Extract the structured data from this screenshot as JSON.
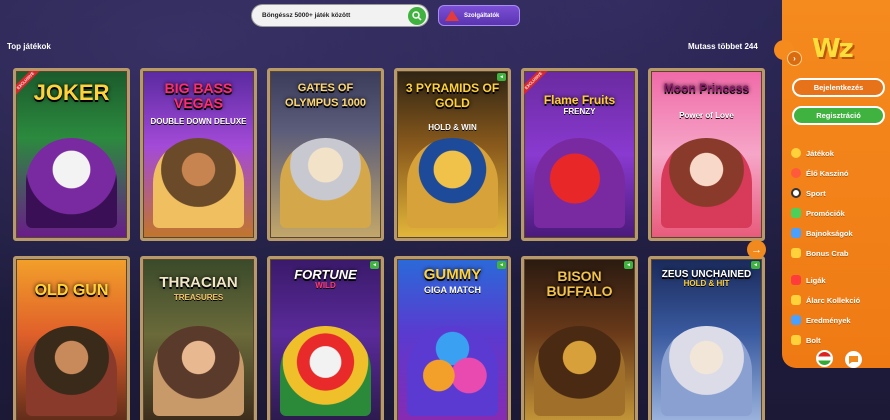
{
  "search": {
    "placeholder": "Böngéssz 5000+ játék között"
  },
  "providers": {
    "label": "Szolgáltatók"
  },
  "section": {
    "title": "Top játékok",
    "more": "Mutass többet 244"
  },
  "games": [
    {
      "name": "JOKER",
      "sub": "",
      "badge": "EXCLUSIVE",
      "quick": false
    },
    {
      "name": "BIG BASS VEGAS",
      "sub": "DOUBLE DOWN DELUXE",
      "badge": "",
      "quick": false
    },
    {
      "name": "GATES OF OLYMPUS 1000",
      "sub": "",
      "badge": "",
      "quick": false
    },
    {
      "name": "3 PYRAMIDS OF GOLD",
      "sub": "HOLD & WIN",
      "badge": "",
      "quick": true
    },
    {
      "name": "Flame Fruits",
      "sub": "FRENZY",
      "badge": "EXCLUSIVE",
      "quick": false
    },
    {
      "name": "Moon Princess",
      "sub": "Power of Love",
      "badge": "",
      "quick": false
    },
    {
      "name": "OLD GUN",
      "sub": "",
      "badge": "",
      "quick": false
    },
    {
      "name": "THRACIAN",
      "sub": "TREASURES",
      "badge": "",
      "quick": false
    },
    {
      "name": "FORTUNE",
      "sub": "WILD",
      "badge": "",
      "quick": true
    },
    {
      "name": "GUMMY",
      "sub": "GIGA MATCH",
      "badge": "",
      "quick": true
    },
    {
      "name": "BISON BUFFALO",
      "sub": "",
      "badge": "",
      "quick": true
    },
    {
      "name": "ZEUS UNCHAINED",
      "sub": "HOLD & HIT",
      "badge": "",
      "quick": true
    }
  ],
  "sidebar": {
    "logo": "Wz",
    "login": "Bejelentkezés",
    "register": "Regisztráció",
    "items": [
      {
        "label": "Játékok",
        "icon": "coin-icon",
        "color": "#ffd23b"
      },
      {
        "label": "Élő Kaszinó",
        "icon": "chip-icon",
        "color": "#ff5a3c"
      },
      {
        "label": "Sport",
        "icon": "ball-icon",
        "color": "#ffffff"
      },
      {
        "label": "Promóciók",
        "icon": "gift-icon",
        "color": "#4cd05a"
      },
      {
        "label": "Bajnokságok",
        "icon": "cup-icon",
        "color": "#4aa0ff"
      },
      {
        "label": "Bonus Crab",
        "icon": "crab-icon",
        "color": "#ffd23b"
      },
      {
        "label": "Ligák",
        "icon": "league-icon",
        "color": "#ff3b3b"
      },
      {
        "label": "Álarc Kollekció",
        "icon": "mask-icon",
        "color": "#ffd23b"
      },
      {
        "label": "Eredmények",
        "icon": "trophy-icon",
        "color": "#4aa0ff"
      },
      {
        "label": "Bolt",
        "icon": "shop-icon",
        "color": "#ffd23b"
      }
    ]
  }
}
